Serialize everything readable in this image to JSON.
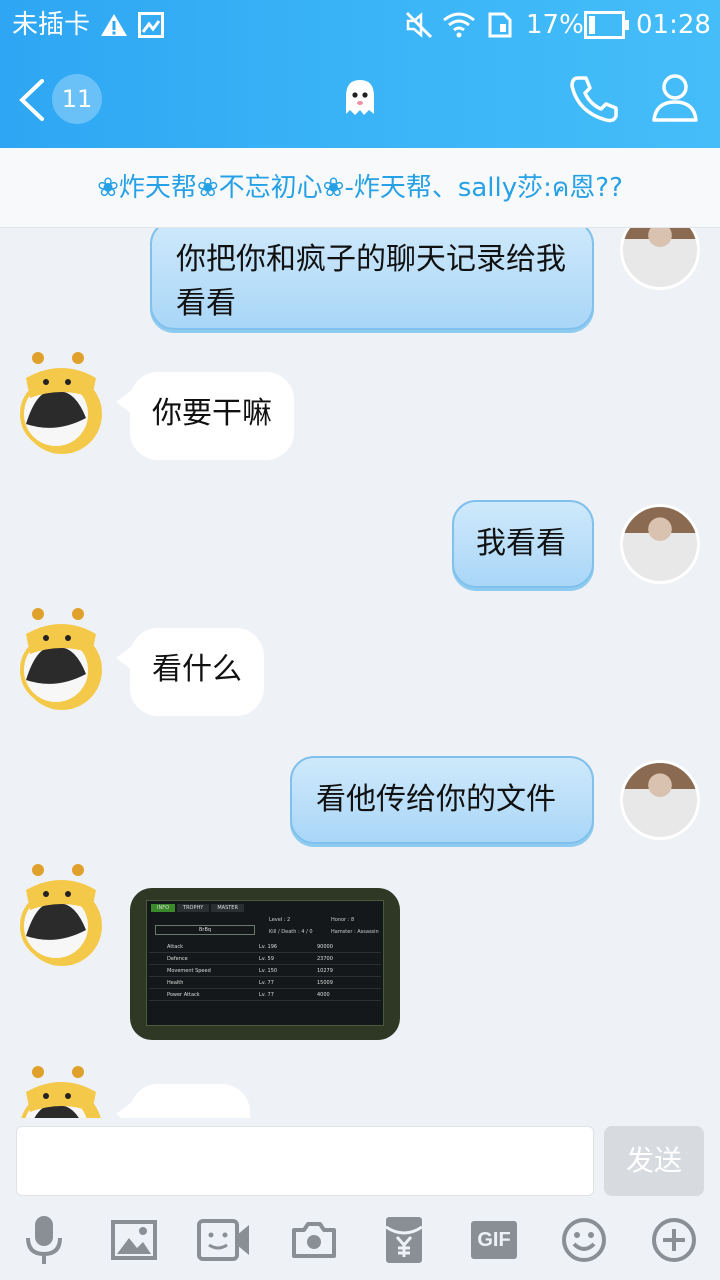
{
  "status_bar": {
    "carrier": "未插卡",
    "battery": "17%",
    "time": "01:28"
  },
  "header": {
    "unread_count": "11"
  },
  "chat": {
    "title": "❀炸天帮❀不忘初心❀-炸天帮、sally莎:ค恩??",
    "messages": [
      {
        "side": "out",
        "text": "你把你和疯子的聊天记录给我看看"
      },
      {
        "side": "in",
        "text": "你要干嘛"
      },
      {
        "side": "out",
        "text": "我看看"
      },
      {
        "side": "in",
        "text": "看什么"
      },
      {
        "side": "out",
        "text": "看他传给你的文件"
      },
      {
        "side": "in",
        "type": "image"
      },
      {
        "side": "in",
        "text": "……"
      }
    ]
  },
  "game_screenshot": {
    "tabs": [
      "INFO",
      "TROPHY",
      "MASTER"
    ],
    "player": "BrBq",
    "level": "Level : 2",
    "honor": "Honor : 8",
    "kd": "Kill / Death : 4 / 0",
    "hamster": "Hamster : Assassin",
    "stats": [
      {
        "name": "Attack",
        "lv": "Lv. 196",
        "val": "90000"
      },
      {
        "name": "Defence",
        "lv": "Lv. 59",
        "val": "23700"
      },
      {
        "name": "Movement Speed",
        "lv": "Lv. 150",
        "val": "10279"
      },
      {
        "name": "Health",
        "lv": "Lv. 77",
        "val": "15009"
      },
      {
        "name": "Power Attack",
        "lv": "Lv. 77",
        "val": "4000"
      }
    ]
  },
  "input": {
    "placeholder": "",
    "send_label": "发送"
  },
  "toolbar": {
    "gif_label": "GIF"
  },
  "colors": {
    "header_blue": "#2ea6f3",
    "title_blue": "#27a1e5",
    "bubble_out": "#a9d6f7"
  }
}
